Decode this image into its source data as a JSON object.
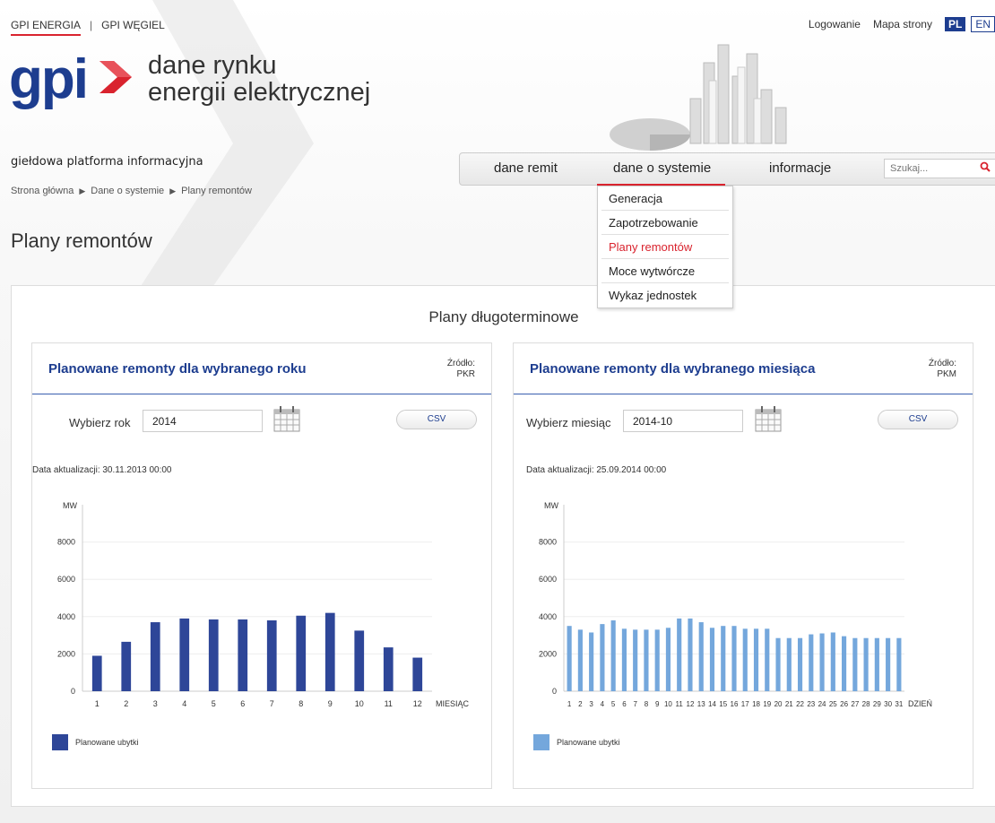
{
  "top": {
    "links": [
      "GPI ENERGIA",
      "GPI WĘGIEL"
    ],
    "login": "Logowanie",
    "sitemap": "Mapa strony",
    "lang_pl": "PL",
    "lang_en": "EN"
  },
  "logo": {
    "mark": "gpi",
    "line1": "dane rynku",
    "line2": "energii elektrycznej"
  },
  "tagline": "giełdowa platforma informacyjna",
  "breadcrumb": [
    "Strona główna",
    "Dane o systemie",
    "Plany remontów"
  ],
  "nav": {
    "items": [
      "dane remit",
      "dane o systemie",
      "informacje"
    ],
    "search_placeholder": "Szukaj...",
    "dropdown": [
      "Generacja",
      "Zapotrzebowanie",
      "Plany remontów",
      "Moce wytwórcze",
      "Wykaz jednostek"
    ]
  },
  "page_title": "Plany remontów",
  "panel_title": "Plany długoterminowe",
  "cards": [
    {
      "title": "Planowane remonty dla wybranego roku",
      "src_label": "Źródło:",
      "src": "PKR",
      "ctl_label": "Wybierz rok",
      "ctl_value": "2014",
      "csv": "CSV",
      "updated": "Data aktualizacji: 30.11.2013 00:00",
      "legend": "Planowane ubytki"
    },
    {
      "title": "Planowane remonty dla wybranego miesiąca",
      "src_label": "Źródło:",
      "src": "PKM",
      "ctl_label": "Wybierz miesiąc",
      "ctl_value": "2014-10",
      "csv": "CSV",
      "updated": "Data aktualizacji: 25.09.2014 00:00",
      "legend": "Planowane ubytki"
    }
  ],
  "colors": {
    "brand": "#1d3d8f",
    "accent": "#d9232e",
    "series_year": "#2e4698",
    "series_month": "#74a7dc"
  },
  "chart_data": [
    {
      "type": "bar",
      "ylabel": "MW",
      "xlabel": "MIESIĄC",
      "ylim": [
        0,
        10000
      ],
      "yticks": [
        0,
        2000,
        4000,
        6000,
        8000
      ],
      "categories": [
        "1",
        "2",
        "3",
        "4",
        "5",
        "6",
        "7",
        "8",
        "9",
        "10",
        "11",
        "12"
      ],
      "series": [
        {
          "name": "Planowane ubytki",
          "values": [
            1900,
            2650,
            3700,
            3900,
            3850,
            3850,
            3800,
            4050,
            4200,
            3250,
            2350,
            1800
          ]
        }
      ]
    },
    {
      "type": "bar",
      "ylabel": "MW",
      "xlabel": "DZIEŃ",
      "ylim": [
        0,
        10000
      ],
      "yticks": [
        0,
        2000,
        4000,
        6000,
        8000
      ],
      "categories": [
        "1",
        "2",
        "3",
        "4",
        "5",
        "6",
        "7",
        "8",
        "9",
        "10",
        "11",
        "12",
        "13",
        "14",
        "15",
        "16",
        "17",
        "18",
        "19",
        "20",
        "21",
        "22",
        "23",
        "24",
        "25",
        "26",
        "27",
        "28",
        "29",
        "30",
        "31"
      ],
      "series": [
        {
          "name": "Planowane ubytki",
          "values": [
            3500,
            3300,
            3150,
            3600,
            3800,
            3350,
            3300,
            3300,
            3300,
            3400,
            3900,
            3900,
            3700,
            3400,
            3500,
            3500,
            3350,
            3350,
            3350,
            2850,
            2850,
            2850,
            3050,
            3100,
            3150,
            2950,
            2850,
            2850,
            2850,
            2850,
            2850
          ]
        }
      ]
    }
  ]
}
